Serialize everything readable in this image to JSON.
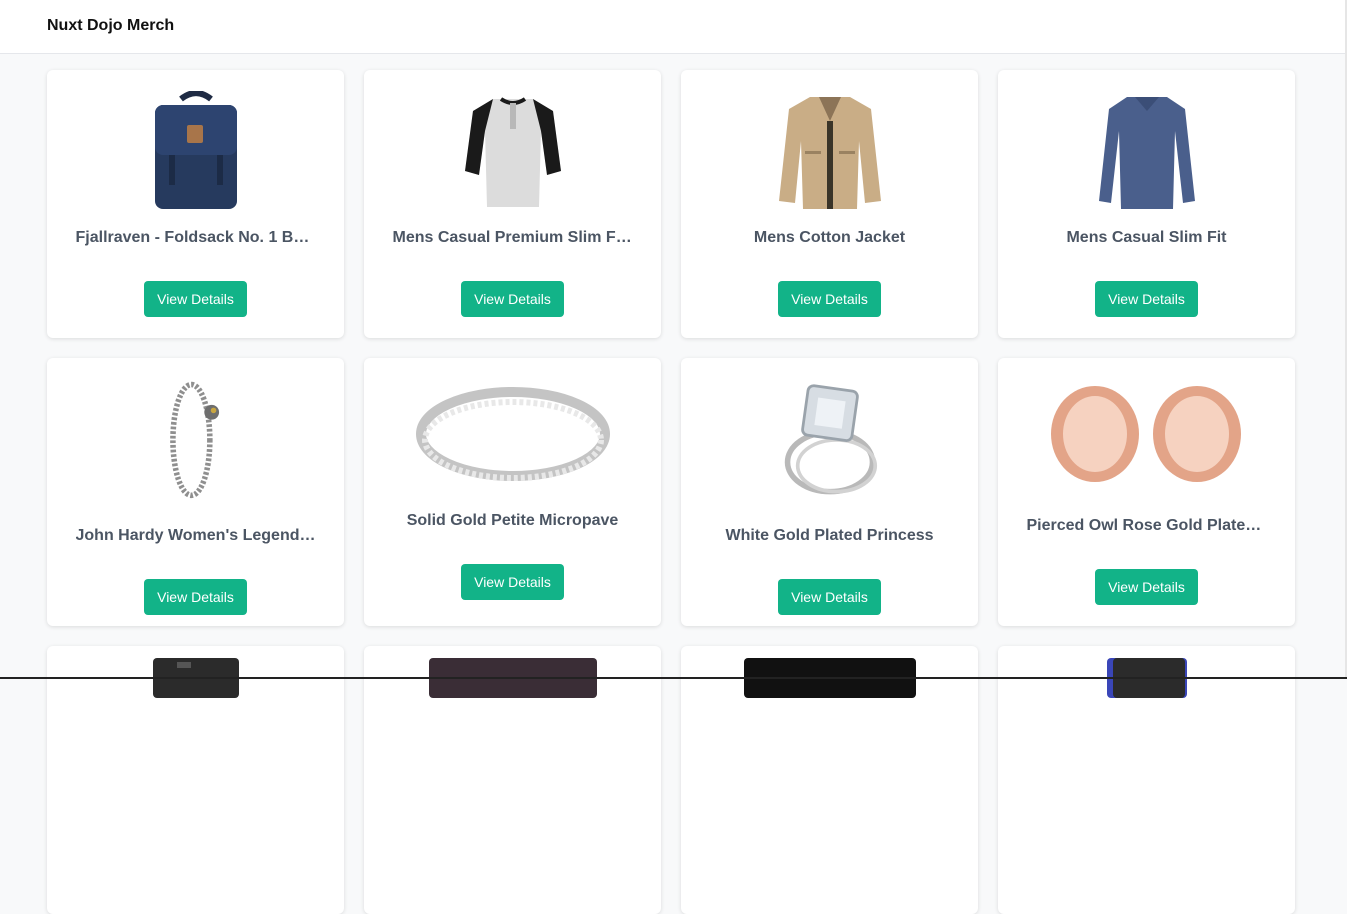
{
  "header": {
    "brand": "Nuxt Dojo Merch"
  },
  "products": [
    {
      "title": "Fjallraven - Foldsack No. 1 Ba...",
      "button": "View Details",
      "image": "backpack"
    },
    {
      "title": "Mens Casual Premium Slim Fi...",
      "button": "View Details",
      "image": "henley-shirt"
    },
    {
      "title": "Mens Cotton Jacket",
      "button": "View Details",
      "image": "jacket"
    },
    {
      "title": "Mens Casual Slim Fit",
      "button": "View Details",
      "image": "long-sleeve-shirt"
    },
    {
      "title": "John Hardy Women's Legends...",
      "button": "View Details",
      "image": "bracelet"
    },
    {
      "title": "Solid Gold Petite Micropave",
      "button": "View Details",
      "image": "ring-band"
    },
    {
      "title": "White Gold Plated Princess",
      "button": "View Details",
      "image": "princess-ring"
    },
    {
      "title": "Pierced Owl Rose Gold Plated ...",
      "button": "View Details",
      "image": "rose-gold-tunnels"
    }
  ],
  "partial_row": [
    {
      "image": "hard-drive"
    },
    {
      "image": "ssd-drive"
    },
    {
      "image": "ssd-drive-black"
    },
    {
      "image": "ssd-drive-blue"
    }
  ],
  "colors": {
    "accent": "#12b388",
    "title": "#4b5563",
    "background": "#f8f9fa"
  }
}
